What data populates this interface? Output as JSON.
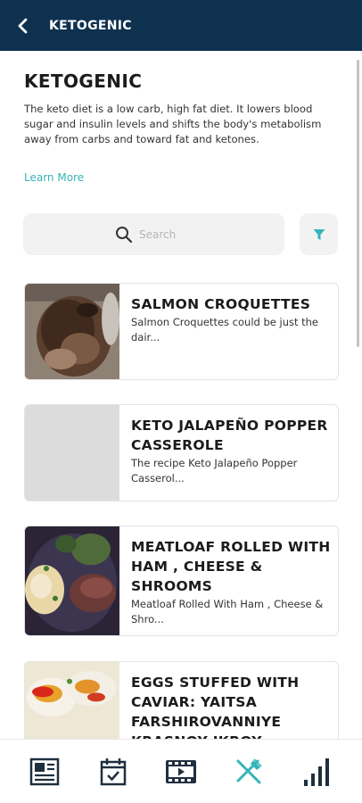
{
  "header": {
    "title": "KETOGENIC",
    "back_icon": "chevron-left-icon"
  },
  "intro": {
    "title": "KETOGENIC",
    "description": "The keto diet is a low carb, high fat diet. It lowers blood sugar and insulin levels and shifts the body's metabolism away from carbs and toward fat and ketones.",
    "learn_more": "Learn More"
  },
  "search": {
    "placeholder": "Search",
    "icon": "search-icon",
    "filter_icon": "filter-icon"
  },
  "recipes": [
    {
      "title": "SALMON CROQUETTES",
      "description": "Salmon Croquettes could be just the dair...",
      "image": "roast-meat-photo"
    },
    {
      "title": "KETO JALAPEÑO POPPER CASSEROLE",
      "description": "The recipe Keto Jalapeño Popper Casserol...",
      "image": "placeholder"
    },
    {
      "title": "MEATLOAF ROLLED WITH HAM , CHEESE & SHROOMS",
      "description": "Meatloaf Rolled With Ham , Cheese & Shro...",
      "image": "meatloaf-plate-photo"
    },
    {
      "title": "EGGS STUFFED WITH CAVIAR: YAITSA FARSHIROVANNIYE KRASNOY IKROY",
      "description": "",
      "image": "stuffed-eggs-photo"
    }
  ],
  "bottom_nav": [
    {
      "name": "articles",
      "icon": "newspaper-icon",
      "active": false
    },
    {
      "name": "planner",
      "icon": "calendar-check-icon",
      "active": false
    },
    {
      "name": "videos",
      "icon": "film-icon",
      "active": false
    },
    {
      "name": "recipes",
      "icon": "fork-knife-icon",
      "active": true
    },
    {
      "name": "stats",
      "icon": "bar-chart-icon",
      "active": false
    }
  ],
  "colors": {
    "header_bg": "#0f3150",
    "accent": "#36b4b8",
    "nav_icon": "#1f2f3f"
  }
}
